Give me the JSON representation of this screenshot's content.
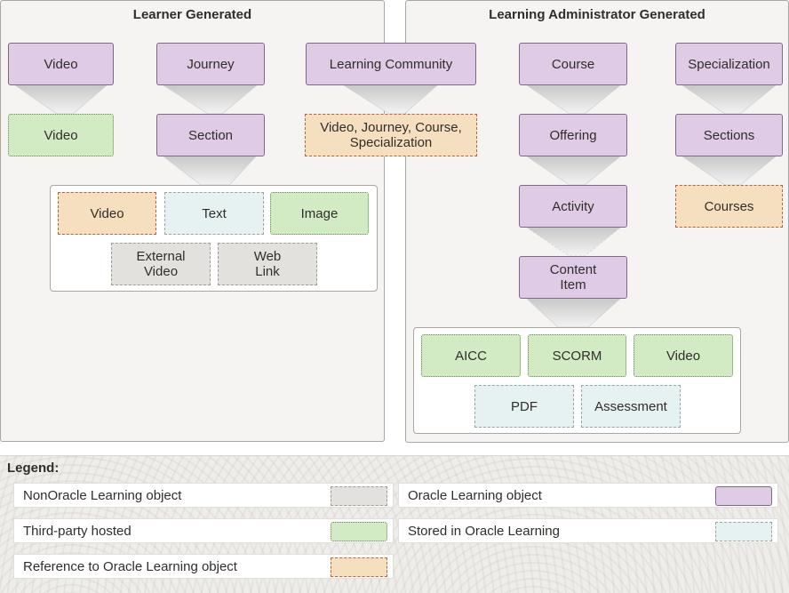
{
  "panels": {
    "learner": {
      "title": "Learner Generated",
      "top_nodes": [
        "Video",
        "Journey",
        "Learning Community"
      ],
      "video_child": "Video",
      "journey_child": "Section",
      "community_child": "Video, Journey, Course, Specialization",
      "section_contents": {
        "row1": [
          "Video",
          "Text",
          "Image"
        ],
        "row2": [
          "External Video",
          "Web Link"
        ]
      }
    },
    "admin": {
      "title": "Learning Administrator Generated",
      "course_chain": [
        "Course",
        "Offering",
        "Activity",
        "Content Item"
      ],
      "specialization_chain": [
        "Specialization",
        "Sections",
        "Courses"
      ],
      "content_item_contents": {
        "row1": [
          "AICC",
          "SCORM",
          "Video"
        ],
        "row2": [
          "PDF",
          "Assessment"
        ]
      }
    }
  },
  "legend": {
    "title": "Legend:",
    "items": [
      {
        "label": "NonOracle Learning object",
        "type": "nonoracle"
      },
      {
        "label": "Oracle Learning object",
        "type": "oracle"
      },
      {
        "label": "Third-party hosted",
        "type": "thirdparty"
      },
      {
        "label": "Stored in Oracle Learning",
        "type": "stored"
      },
      {
        "label": "Reference to Oracle Learning object",
        "type": "reference"
      }
    ]
  },
  "colors": {
    "oracle": "#dfcbe5",
    "thirdparty": "#d3ebc4",
    "reference": "#f5dfbf",
    "stored": "#e6f1f1",
    "nonoracle": "#e3e1de"
  }
}
